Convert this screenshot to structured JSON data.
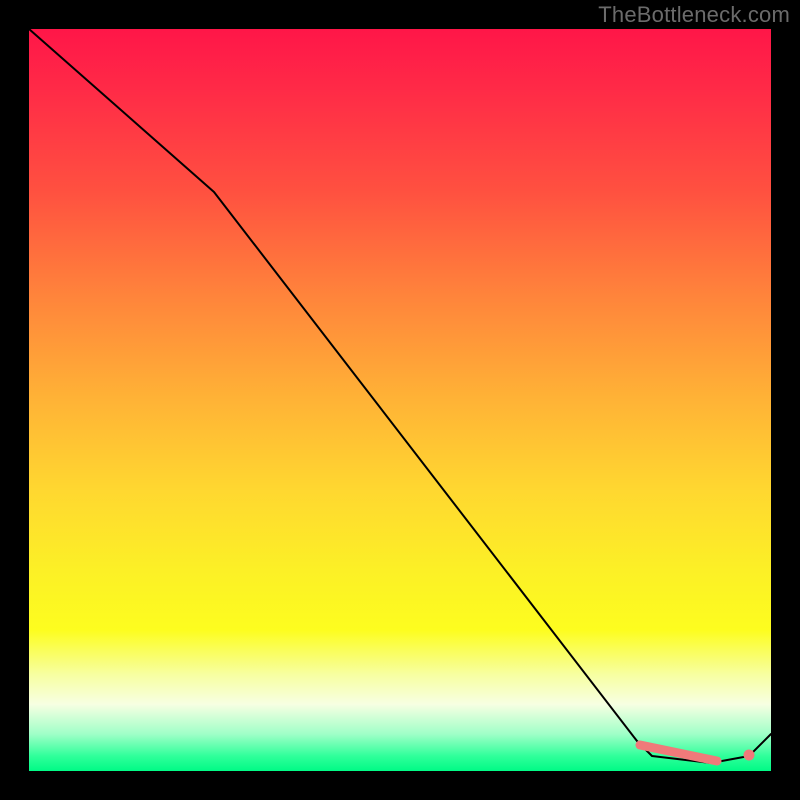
{
  "watermark": "TheBottleneck.com",
  "chart_data": {
    "type": "line",
    "title": "",
    "xlabel": "",
    "ylabel": "",
    "xlim": [
      0,
      100
    ],
    "ylim": [
      0,
      100
    ],
    "grid": false,
    "legend": false,
    "series": [
      {
        "name": "bottleneck-curve",
        "x": [
          0,
          25,
          82,
          84,
          92,
          97,
          100
        ],
        "y": [
          100,
          78,
          4,
          2,
          1,
          2,
          5
        ]
      }
    ],
    "highlight_band": {
      "name": "optimal-range",
      "x_start": 82,
      "x_end": 92,
      "y": 2
    },
    "highlight_point": {
      "name": "marker",
      "x": 97,
      "y": 2
    },
    "background_gradient": {
      "top": "#ff1648",
      "bottom": "#00fa86",
      "stops": [
        "red",
        "orange",
        "yellow",
        "pale-yellow",
        "white-green",
        "green"
      ]
    }
  }
}
